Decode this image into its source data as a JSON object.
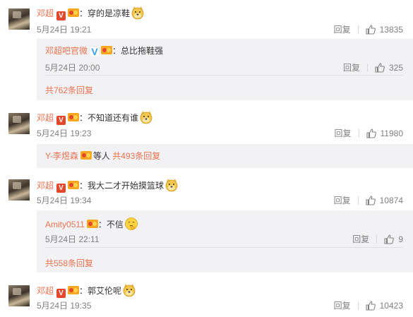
{
  "colors": {
    "accent": "#eb7350",
    "muted": "#808080",
    "reply_bg": "#f2f2f5",
    "verified_red": "#e5472d",
    "verified_blue": "#3aa0e8"
  },
  "actions": {
    "reply_label": "回复"
  },
  "comments": [
    {
      "user": "邓超",
      "text": "：穿的是凉鞋",
      "time": "5月24日 19:21",
      "likes": "13835",
      "reply": {
        "user": "邓超吧官微",
        "text": "：总比拖鞋强",
        "time": "5月24日 20:00",
        "likes": "325"
      },
      "total": "共762条回复"
    },
    {
      "user": "邓超",
      "text": "：不知道还有谁",
      "time": "5月24日 19:23",
      "likes": "11980",
      "summary": {
        "user": "Y-李煜森",
        "text": "等人",
        "total": "共493条回复"
      }
    },
    {
      "user": "邓超",
      "text": "：我大二才开始摸篮球",
      "time": "5月24日 19:34",
      "likes": "10874",
      "reply": {
        "user": "Amity0511",
        "text": "：不信",
        "time": "5月24日 22:11",
        "likes": "9"
      },
      "total": "共558条回复"
    },
    {
      "user": "邓超",
      "text": "：郭艾伦呢",
      "time": "5月24日 19:35",
      "likes": "10423"
    }
  ]
}
